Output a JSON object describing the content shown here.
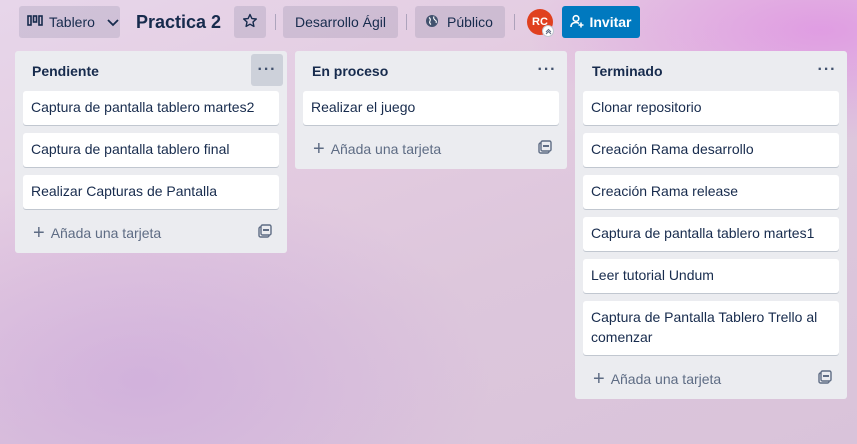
{
  "header": {
    "view_label": "Tablero",
    "board_title": "Practica 2",
    "workspace_label": "Desarrollo Ágil",
    "visibility_label": "Público",
    "avatar_initials": "RC",
    "invite_label": "Invitar"
  },
  "lists": [
    {
      "title": "Pendiente",
      "cards": [
        "Captura de pantalla tablero martes2",
        "Captura de pantalla tablero final",
        "Realizar Capturas de Pantalla"
      ],
      "add_label": "Añada una tarjeta"
    },
    {
      "title": "En proceso",
      "cards": [
        "Realizar el juego"
      ],
      "add_label": "Añada una tarjeta"
    },
    {
      "title": "Terminado",
      "cards": [
        "Clonar repositorio",
        "Creación Rama desarrollo",
        "Creación Rama release",
        "Captura de pantalla tablero martes1",
        "Leer tutorial Undum",
        "Captura de Pantalla Tablero Trello al comenzar"
      ],
      "add_label": "Añada una tarjeta"
    }
  ],
  "colors": {
    "invite_button": "#0079bf",
    "avatar": "#e0401f",
    "list_background": "#ebecf0"
  },
  "icons": {
    "view": "board-icon",
    "star": "star-icon",
    "visibility": "globe-icon",
    "invite": "add-user-icon",
    "list_menu": "more-icon",
    "template": "template-icon"
  }
}
